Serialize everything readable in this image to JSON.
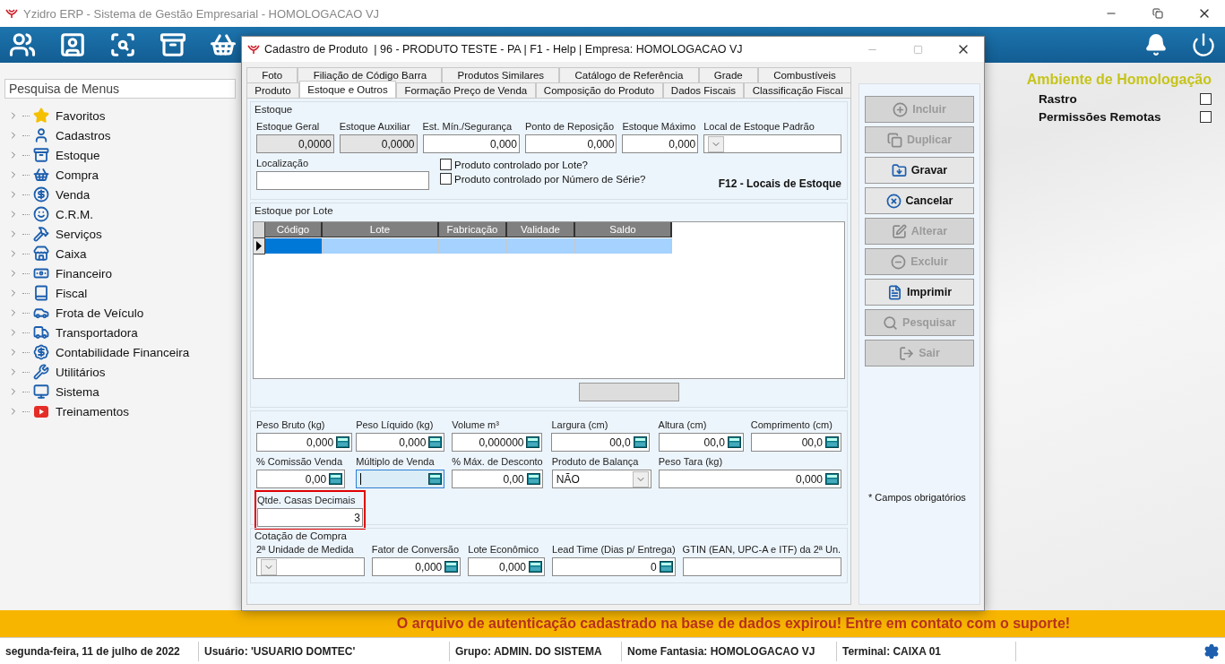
{
  "app": {
    "title": "Yzidro ERP - Sistema de Gestão Empresarial - HOMOLOGACAO VJ"
  },
  "sidebar": {
    "search_placeholder": "Pesquisa de Menus",
    "items": [
      {
        "label": "Favoritos"
      },
      {
        "label": "Cadastros"
      },
      {
        "label": "Estoque"
      },
      {
        "label": "Compra"
      },
      {
        "label": "Venda"
      },
      {
        "label": "C.R.M."
      },
      {
        "label": "Serviços"
      },
      {
        "label": "Caixa"
      },
      {
        "label": "Financeiro"
      },
      {
        "label": "Fiscal"
      },
      {
        "label": "Frota de Veículo"
      },
      {
        "label": "Transportadora"
      },
      {
        "label": "Contabilidade Financeira"
      },
      {
        "label": "Utilitários"
      },
      {
        "label": "Sistema"
      },
      {
        "label": "Treinamentos"
      }
    ]
  },
  "environment": {
    "title": "Ambiente de Homologação",
    "options": [
      {
        "label": "Rastro",
        "checked": false
      },
      {
        "label": "Permissões Remotas",
        "checked": false
      }
    ]
  },
  "dialog": {
    "title": "Cadastro de Produto  | 96 - PRODUTO TESTE - PA | F1 - Help | Empresa: HOMOLOGACAO VJ",
    "tabs_row_1": [
      {
        "label": "Foto",
        "selected": false
      },
      {
        "label": "Filiação de Código Barra",
        "selected": false
      },
      {
        "label": "Produtos Similares",
        "selected": false
      },
      {
        "label": "Catálogo de Referência",
        "selected": false
      },
      {
        "label": "Grade",
        "selected": false
      },
      {
        "label": "Combustíveis",
        "selected": false
      }
    ],
    "tabs_row_2": [
      {
        "label": "Produto",
        "selected": false
      },
      {
        "label": "Estoque e Outros",
        "selected": true
      },
      {
        "label": "Formação Preço de Venda",
        "selected": false
      },
      {
        "label": "Composição do Produto",
        "selected": false
      },
      {
        "label": "Dados Fiscais",
        "selected": false
      },
      {
        "label": "Classificação Fiscal",
        "selected": false
      }
    ],
    "estoque": {
      "legend": "Estoque",
      "fields": [
        {
          "label": "Estoque Geral",
          "value": "0,0000",
          "kind": "readonly"
        },
        {
          "label": "Estoque Auxiliar",
          "value": "0,0000",
          "kind": "readonly"
        },
        {
          "label": "Est. Mín./Segurança",
          "value": "0,000",
          "kind": "text"
        },
        {
          "label": "Ponto de Reposição",
          "value": "0,000",
          "kind": "text"
        },
        {
          "label": "Estoque Máximo",
          "value": "0,000",
          "kind": "text"
        },
        {
          "label": "Local de Estoque Padrão",
          "kind": "select"
        }
      ],
      "location": {
        "label": "Localização"
      },
      "checkboxes": [
        {
          "label": "Produto controlado por Lote?",
          "checked": false
        },
        {
          "label": "Produto controlado por Número de Série?",
          "checked": false
        }
      ],
      "shortcut": "F12 - Locais de Estoque"
    },
    "lote": {
      "legend": "Estoque por Lote",
      "columns": [
        "Código",
        "Lote",
        "Fabricação",
        "Validade",
        "Saldo"
      ],
      "rows": [
        {
          "selected": true
        }
      ]
    },
    "medidas": {
      "rows": [
        [
          {
            "label": "Peso Bruto (kg)",
            "value": "0,000",
            "kind": "calc"
          },
          {
            "label": "Peso Líquido (kg)",
            "value": "0,000",
            "kind": "calc"
          },
          {
            "label": "Volume m³",
            "value": "0,000000",
            "kind": "calc"
          },
          {
            "label": "Largura (cm)",
            "value": "00,0",
            "kind": "calc"
          },
          {
            "label": "Altura (cm)",
            "value": "00,0",
            "kind": "calc"
          },
          {
            "label": "Comprimento (cm)",
            "value": "00,0",
            "kind": "calc"
          }
        ],
        [
          {
            "label": "% Comissão Venda",
            "value": "0,00",
            "kind": "calc"
          },
          {
            "label": "Múltiplo de Venda",
            "kind": "calc",
            "focused": true
          },
          {
            "label": "% Máx. de Desconto",
            "value": "0,00",
            "kind": "calc"
          },
          {
            "label": "Produto de Balança",
            "value": "NÃO",
            "kind": "select"
          },
          {
            "label": "Peso Tara (kg)",
            "value": "0,000",
            "kind": "calc"
          }
        ],
        [
          {
            "label": "Qtde. Casas Decimais",
            "value": "3",
            "kind": "text",
            "highlighted": true
          }
        ]
      ]
    },
    "cotacao": {
      "legend": "Cotação de Compra",
      "fields": [
        {
          "label": "2ª Unidade de Medida",
          "kind": "select"
        },
        {
          "label": "Fator de Conversão",
          "value": "0,000",
          "kind": "calc"
        },
        {
          "label": "Lote Econômico",
          "value": "0,000",
          "kind": "calc"
        },
        {
          "label": "Lead Time (Dias p/ Entrega)",
          "value": "0",
          "kind": "calc"
        },
        {
          "label": "GTIN (EAN, UPC-A e ITF) da 2ª Un.",
          "kind": "text"
        }
      ]
    },
    "buttons": [
      {
        "label": "Incluir",
        "disabled": true
      },
      {
        "label": "Duplicar",
        "disabled": true
      },
      {
        "label": "Gravar",
        "disabled": false
      },
      {
        "label": "Cancelar",
        "disabled": false
      },
      {
        "label": "Alterar",
        "disabled": true
      },
      {
        "label": "Excluir",
        "disabled": true
      },
      {
        "label": "Imprimir",
        "disabled": false
      },
      {
        "label": "Pesquisar",
        "disabled": true
      },
      {
        "label": "Sair",
        "disabled": true
      }
    ],
    "required_note": "* Campos obrigatórios"
  },
  "banner": "O arquivo de autenticação cadastrado na base de dados expirou! Entre em contato com o suporte!",
  "status_bar": [
    "segunda-feira, 11 de julho de 2022",
    "Usuário: 'USUARIO DOMTEC'",
    "Grupo: ADMIN. DO SISTEMA",
    "Nome Fantasia: HOMOLOGACAO VJ",
    "Terminal: CAIXA 01"
  ]
}
